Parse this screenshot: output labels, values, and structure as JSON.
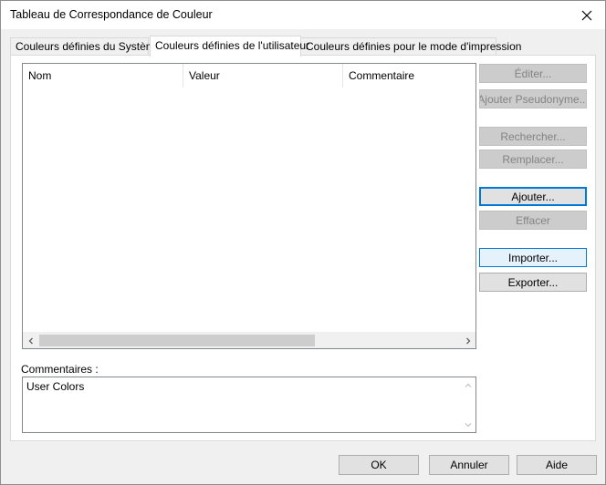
{
  "window": {
    "title": "Tableau de Correspondance de Couleur",
    "close_icon": "close-icon"
  },
  "tabs": [
    {
      "label": "Couleurs définies du Système",
      "active": false
    },
    {
      "label": "Couleurs définies de l'utilisateur",
      "active": true
    },
    {
      "label": "Couleurs définies pour le mode d'impression",
      "active": false
    }
  ],
  "list": {
    "columns": [
      "Nom",
      "Valeur",
      "Commentaire"
    ],
    "rows": []
  },
  "comments": {
    "label": "Commentaires :",
    "value": "User Colors"
  },
  "side_buttons": {
    "edit": "Éditer...",
    "add_alias": "Ajouter Pseudonyme...",
    "find": "Rechercher...",
    "replace": "Remplacer...",
    "add": "Ajouter...",
    "delete": "Effacer",
    "import": "Importer...",
    "export": "Exporter..."
  },
  "footer": {
    "ok": "OK",
    "cancel": "Annuler",
    "help": "Aide"
  },
  "colors": {
    "accent": "#0078d7",
    "disabled_text": "#838383"
  }
}
